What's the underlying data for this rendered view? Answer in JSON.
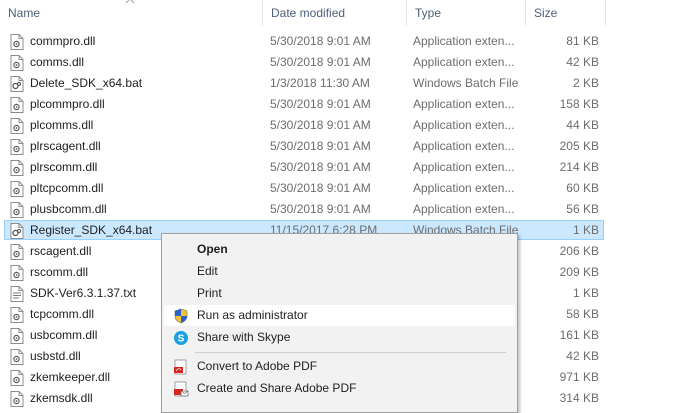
{
  "columns": {
    "name": "Name",
    "date": "Date modified",
    "type": "Type",
    "size": "Size"
  },
  "files": [
    {
      "name": "commpro.dll",
      "date": "5/30/2018 9:01 AM",
      "type": "Application exten...",
      "size": "81 KB",
      "icon": "dll-file-icon"
    },
    {
      "name": "comms.dll",
      "date": "5/30/2018 9:01 AM",
      "type": "Application exten...",
      "size": "42 KB",
      "icon": "dll-file-icon"
    },
    {
      "name": "Delete_SDK_x64.bat",
      "date": "1/3/2018 11:30 AM",
      "type": "Windows Batch File",
      "size": "2 KB",
      "icon": "batch-file-icon"
    },
    {
      "name": "plcommpro.dll",
      "date": "5/30/2018 9:01 AM",
      "type": "Application exten...",
      "size": "158 KB",
      "icon": "dll-file-icon"
    },
    {
      "name": "plcomms.dll",
      "date": "5/30/2018 9:01 AM",
      "type": "Application exten...",
      "size": "44 KB",
      "icon": "dll-file-icon"
    },
    {
      "name": "plrscagent.dll",
      "date": "5/30/2018 9:01 AM",
      "type": "Application exten...",
      "size": "205 KB",
      "icon": "dll-file-icon"
    },
    {
      "name": "plrscomm.dll",
      "date": "5/30/2018 9:01 AM",
      "type": "Application exten...",
      "size": "214 KB",
      "icon": "dll-file-icon"
    },
    {
      "name": "pltcpcomm.dll",
      "date": "5/30/2018 9:01 AM",
      "type": "Application exten...",
      "size": "60 KB",
      "icon": "dll-file-icon"
    },
    {
      "name": "plusbcomm.dll",
      "date": "5/30/2018 9:01 AM",
      "type": "Application exten...",
      "size": "56 KB",
      "icon": "dll-file-icon"
    },
    {
      "name": "Register_SDK_x64.bat",
      "date": "11/15/2017 6:28 PM",
      "type": "Windows Batch File",
      "size": "1 KB",
      "icon": "batch-file-icon",
      "selected": true
    },
    {
      "name": "rscagent.dll",
      "date": "",
      "type": "",
      "size": "206 KB",
      "icon": "dll-file-icon"
    },
    {
      "name": "rscomm.dll",
      "date": "",
      "type": "",
      "size": "209 KB",
      "icon": "dll-file-icon"
    },
    {
      "name": "SDK-Ver6.3.1.37.txt",
      "date": "",
      "type": "",
      "size": "1 KB",
      "icon": "text-file-icon"
    },
    {
      "name": "tcpcomm.dll",
      "date": "",
      "type": "",
      "size": "58 KB",
      "icon": "dll-file-icon"
    },
    {
      "name": "usbcomm.dll",
      "date": "",
      "type": "",
      "size": "161 KB",
      "icon": "dll-file-icon"
    },
    {
      "name": "usbstd.dll",
      "date": "",
      "type": "",
      "size": "42 KB",
      "icon": "dll-file-icon"
    },
    {
      "name": "zkemkeeper.dll",
      "date": "",
      "type": "",
      "size": "971 KB",
      "icon": "dll-file-icon"
    },
    {
      "name": "zkemsdk.dll",
      "date": "",
      "type": "",
      "size": "314 KB",
      "icon": "dll-file-icon"
    }
  ],
  "context_menu": {
    "open": "Open",
    "edit": "Edit",
    "print": "Print",
    "run_as_admin": "Run as administrator",
    "share_skype": "Share with Skype",
    "convert_pdf": "Convert to Adobe PDF",
    "create_share_pdf": "Create and Share Adobe PDF"
  },
  "colors": {
    "selection": "#cce8ff",
    "selection_border": "#99d1ff",
    "header_text": "#4c607a",
    "menu_bg": "#f2f2f2"
  }
}
